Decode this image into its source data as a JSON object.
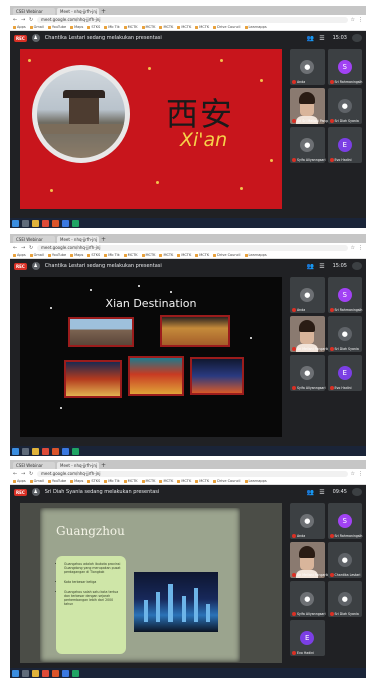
{
  "screens": [
    {
      "tabs": [
        "CSEI Webinar",
        "Meet - nhq-jjrfh-jnj"
      ],
      "url": "meet.google.com/nhq-jjrfh-jnj",
      "bookmarks": [
        "Apps",
        "Gmail",
        "YouTube",
        "Maps",
        "STKS",
        "Mb Tik",
        "MCTK",
        "MCTK",
        "MCTK",
        "MCTK",
        "MCTK",
        "Drive Council",
        "Learnapps",
        "Paypal Express"
      ],
      "presenter": "Chantika Lestari sedang melakukan presentasi",
      "rec_label": "REC",
      "time": "15:03",
      "slide": {
        "title_cn": "西安",
        "title_pinyin": "Xi'an"
      },
      "participants": [
        {
          "name": "Anda",
          "initial": "",
          "color": "#6d7074",
          "kind": "avatar"
        },
        {
          "name": "Sri Rahmaningsih",
          "initial": "S",
          "color": "#a142f4",
          "kind": "avatar"
        },
        {
          "name": "Sri Sri Meilani Pangaribuan",
          "initial": "",
          "color": "#8a7a70",
          "kind": "video"
        },
        {
          "name": "Sri Diah Syania",
          "initial": "",
          "color": "#5f6368",
          "kind": "avatar"
        },
        {
          "name": "Syifa Aliyanngsari",
          "initial": "",
          "color": "#6d7074",
          "kind": "avatar"
        },
        {
          "name": "Evo Hadini",
          "initial": "E",
          "color": "#7b3fe4",
          "kind": "avatar"
        }
      ]
    },
    {
      "tabs": [
        "CSEI Webinar",
        "Meet - nhq-jjrfh-jnj"
      ],
      "url": "meet.google.com/nhq-jjrfh-jnj",
      "presenter": "Chantika Lestari sedang melakukan presentasi",
      "rec_label": "REC",
      "time": "15:05",
      "slide": {
        "title": "Xian Destination"
      },
      "participants": [
        {
          "name": "Anda",
          "initial": "",
          "color": "#6d7074",
          "kind": "avatar"
        },
        {
          "name": "Sri Rahmaningsih",
          "initial": "S",
          "color": "#a142f4",
          "kind": "avatar"
        },
        {
          "name": "Sri Meilani Pangaribuan",
          "initial": "",
          "color": "#8a7a70",
          "kind": "video"
        },
        {
          "name": "Sri Diah Syania",
          "initial": "",
          "color": "#5f6368",
          "kind": "avatar"
        },
        {
          "name": "Syifa Aliyanngsari",
          "initial": "",
          "color": "#6d7074",
          "kind": "avatar"
        },
        {
          "name": "Evo Hadini",
          "initial": "E",
          "color": "#7b3fe4",
          "kind": "avatar"
        }
      ]
    },
    {
      "tabs": [
        "CSEI Webinar",
        "Meet - nhq-jjrfh-jnj"
      ],
      "url": "meet.google.com/nhq-jjrfh-jnj",
      "presenter": "Sri Diah Syania sedang melakukan presentasi",
      "rec_label": "REC",
      "time": "09:45",
      "slide": {
        "title": "Guangzhou",
        "bullets": [
          "Guangzhou adalah ibukota provinsi Guangdong yang merupakan pusat perdagangan di Tiongkok",
          "Kota terbesar ketiga",
          "Guangzhou salah satu kota tertua dan terbesar dengan sejarah perkembangan lebih dari 2000 tahun"
        ]
      },
      "participants": [
        {
          "name": "Anda",
          "initial": "",
          "color": "#6d7074",
          "kind": "avatar"
        },
        {
          "name": "Sri Rahmaningsih",
          "initial": "S",
          "color": "#a142f4",
          "kind": "avatar"
        },
        {
          "name": "Sri Meilani Pangaribuan",
          "initial": "",
          "color": "#8a7a70",
          "kind": "video"
        },
        {
          "name": "Chantika Lestari",
          "initial": "",
          "color": "#5f6368",
          "kind": "avatar"
        },
        {
          "name": "Syifa Aliyanngsari",
          "initial": "",
          "color": "#6d7074",
          "kind": "avatar"
        },
        {
          "name": "Sri Diah Syania",
          "initial": "",
          "color": "#5f6368",
          "kind": "avatar"
        },
        {
          "name": "Evo Hadini",
          "initial": "E",
          "color": "#7b3fe4",
          "kind": "avatar"
        }
      ]
    }
  ],
  "colors": {
    "meet_bg": "#202124",
    "rec": "#d93025",
    "slide1_red": "#c8151c",
    "pinyin_gold": "#f6d24a"
  }
}
